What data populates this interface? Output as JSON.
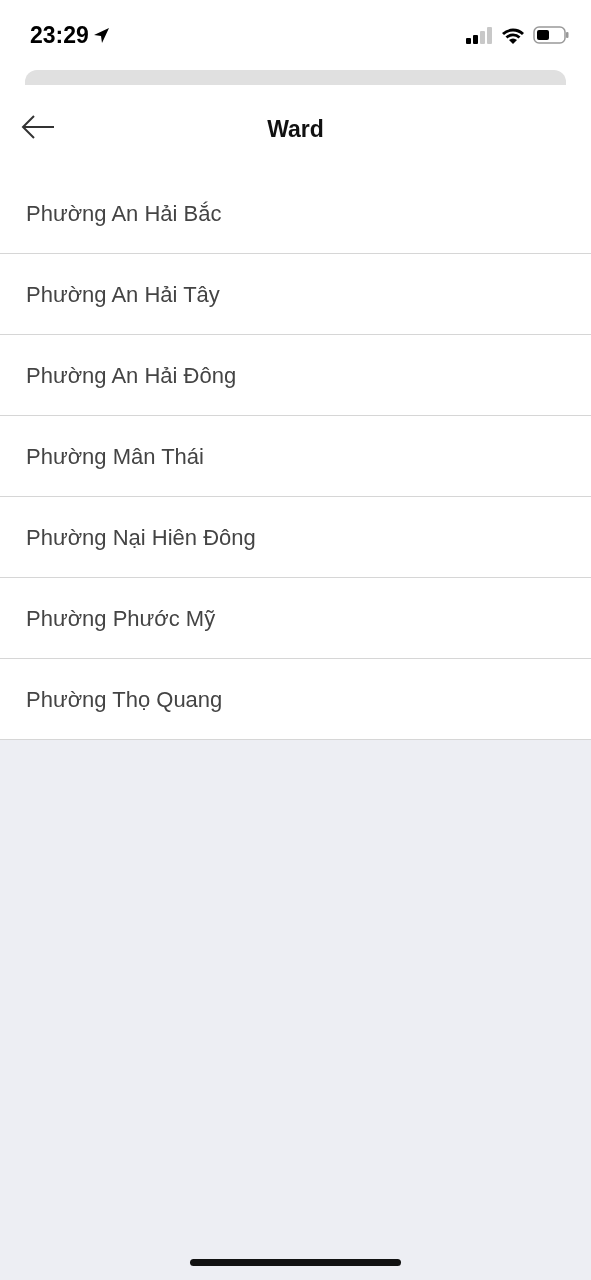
{
  "status_bar": {
    "time": "23:29"
  },
  "header": {
    "title": "Ward"
  },
  "wards": [
    {
      "name": "Phường An Hải Bắc"
    },
    {
      "name": "Phường An Hải Tây"
    },
    {
      "name": "Phường An Hải Đông"
    },
    {
      "name": "Phường Mân Thái"
    },
    {
      "name": "Phường Nại Hiên Đông"
    },
    {
      "name": "Phường Phước Mỹ"
    },
    {
      "name": "Phường Thọ Quang"
    }
  ]
}
